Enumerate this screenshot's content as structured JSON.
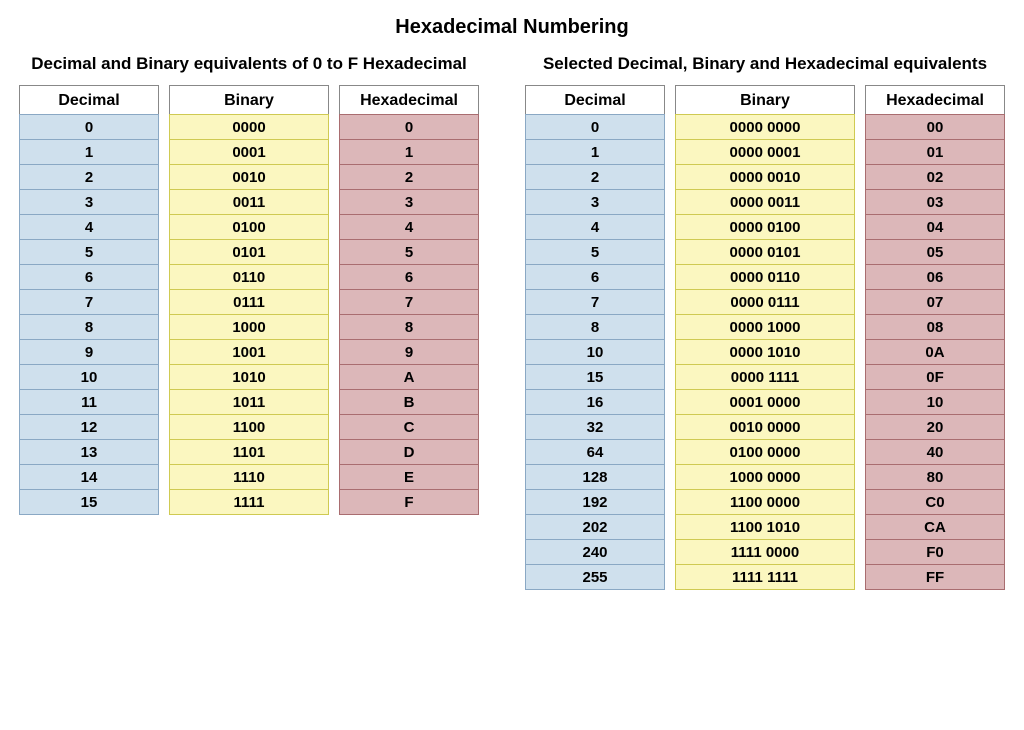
{
  "title": "Hexadecimal Numbering",
  "left": {
    "subtitle": "Decimal and Binary equivalents of 0 to F Hexadecimal",
    "headers": {
      "dec": "Decimal",
      "bin": "Binary",
      "hex": "Hexadecimal"
    },
    "rows": [
      {
        "dec": "0",
        "bin": "0000",
        "hex": "0"
      },
      {
        "dec": "1",
        "bin": "0001",
        "hex": "1"
      },
      {
        "dec": "2",
        "bin": "0010",
        "hex": "2"
      },
      {
        "dec": "3",
        "bin": "0011",
        "hex": "3"
      },
      {
        "dec": "4",
        "bin": "0100",
        "hex": "4"
      },
      {
        "dec": "5",
        "bin": "0101",
        "hex": "5"
      },
      {
        "dec": "6",
        "bin": "0110",
        "hex": "6"
      },
      {
        "dec": "7",
        "bin": "0111",
        "hex": "7"
      },
      {
        "dec": "8",
        "bin": "1000",
        "hex": "8"
      },
      {
        "dec": "9",
        "bin": "1001",
        "hex": "9"
      },
      {
        "dec": "10",
        "bin": "1010",
        "hex": "A"
      },
      {
        "dec": "11",
        "bin": "1011",
        "hex": "B"
      },
      {
        "dec": "12",
        "bin": "1100",
        "hex": "C"
      },
      {
        "dec": "13",
        "bin": "1101",
        "hex": "D"
      },
      {
        "dec": "14",
        "bin": "1110",
        "hex": "E"
      },
      {
        "dec": "15",
        "bin": "1111",
        "hex": "F"
      }
    ]
  },
  "right": {
    "subtitle": "Selected Decimal, Binary and Hexadecimal equivalents",
    "headers": {
      "dec": "Decimal",
      "bin": "Binary",
      "hex": "Hexadecimal"
    },
    "rows": [
      {
        "dec": "0",
        "bin": "0000 0000",
        "hex": "00"
      },
      {
        "dec": "1",
        "bin": "0000 0001",
        "hex": "01"
      },
      {
        "dec": "2",
        "bin": "0000 0010",
        "hex": "02"
      },
      {
        "dec": "3",
        "bin": "0000 0011",
        "hex": "03"
      },
      {
        "dec": "4",
        "bin": "0000 0100",
        "hex": "04"
      },
      {
        "dec": "5",
        "bin": "0000 0101",
        "hex": "05"
      },
      {
        "dec": "6",
        "bin": "0000 0110",
        "hex": "06"
      },
      {
        "dec": "7",
        "bin": "0000 0111",
        "hex": "07"
      },
      {
        "dec": "8",
        "bin": "0000 1000",
        "hex": "08"
      },
      {
        "dec": "10",
        "bin": "0000 1010",
        "hex": "0A"
      },
      {
        "dec": "15",
        "bin": "0000 1111",
        "hex": "0F"
      },
      {
        "dec": "16",
        "bin": "0001 0000",
        "hex": "10"
      },
      {
        "dec": "32",
        "bin": "0010 0000",
        "hex": "20"
      },
      {
        "dec": "64",
        "bin": "0100 0000",
        "hex": "40"
      },
      {
        "dec": "128",
        "bin": "1000 0000",
        "hex": "80"
      },
      {
        "dec": "192",
        "bin": "1100 0000",
        "hex": "C0"
      },
      {
        "dec": "202",
        "bin": "1100 1010",
        "hex": "CA"
      },
      {
        "dec": "240",
        "bin": "1111 0000",
        "hex": "F0"
      },
      {
        "dec": "255",
        "bin": "1111 1111",
        "hex": "FF"
      }
    ]
  }
}
